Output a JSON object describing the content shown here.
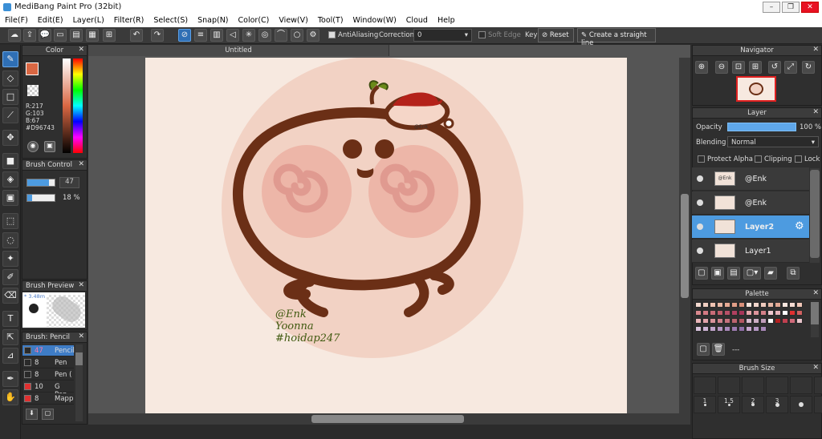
{
  "window": {
    "title": "MediBang Paint Pro (32bit)"
  },
  "menu": [
    "File(F)",
    "Edit(E)",
    "Layer(L)",
    "Filter(R)",
    "Select(S)",
    "Snap(N)",
    "Color(C)",
    "View(V)",
    "Tool(T)",
    "Window(W)",
    "Cloud",
    "Help"
  ],
  "toolbar": {
    "antialiasing": "AntiAliasing",
    "correction_label": "Correction",
    "correction_value": "0",
    "soft_edge": "Soft Edge",
    "key_label": "Key",
    "reset": "Reset",
    "straight_line": "Create a straight line"
  },
  "color_panel": {
    "title": "Color",
    "r": "R:217",
    "g": "G:103",
    "b": "B:67",
    "hex": "#D96743",
    "fg_color": "#D96743"
  },
  "brush_control": {
    "title": "Brush Control",
    "size": "47",
    "opacity": "18 %"
  },
  "brush_preview": {
    "title": "Brush Preview",
    "size_text": "* 3.48m"
  },
  "brush_list": {
    "title": "Brush: Pencil",
    "items": [
      {
        "size": "47",
        "name": "Pencil",
        "color": "#2a2a2a"
      },
      {
        "size": "8",
        "name": "Pen",
        "color": "#2a2a2a"
      },
      {
        "size": "8",
        "name": "Pen (",
        "color": "#2a2a2a"
      },
      {
        "size": "10",
        "name": "G Pen",
        "color": "#e03030"
      },
      {
        "size": "8",
        "name": "Mapp",
        "color": "#e03030"
      }
    ]
  },
  "document": {
    "tab": "Untitled"
  },
  "artwork": {
    "line1": "@Enk",
    "line2": "Yoonna",
    "line3": "#hoidap247",
    "hat_tag": "@Enk"
  },
  "navigator": {
    "title": "Navigator"
  },
  "layer_panel": {
    "title": "Layer",
    "opacity_label": "Opacity",
    "opacity_value": "100 %",
    "blending_label": "Blending",
    "blending_value": "Normal",
    "protect_alpha": "Protect Alpha",
    "clipping": "Clipping",
    "lock": "Lock",
    "layers": [
      {
        "name": "@Enk",
        "selected": false,
        "thumb": "@Enk"
      },
      {
        "name": "@Enk",
        "selected": false,
        "thumb": ""
      },
      {
        "name": "Layer2",
        "selected": true,
        "thumb": ""
      },
      {
        "name": "Layer1",
        "selected": false,
        "thumb": ""
      }
    ]
  },
  "palette": {
    "title": "Palette",
    "dash": "---",
    "rows": [
      [
        "#f3d9cf",
        "#f0cfc2",
        "#efc3b2",
        "#eab8a5",
        "#e8aa94",
        "#e09e88",
        "#d99079",
        "#f6e4dc",
        "#f2d6cc",
        "#eecabd",
        "#e7b8a6",
        "#e1a792",
        "#f8e6de",
        "#f4dbd2",
        "#f0c7b8"
      ],
      [
        "#d9888e",
        "#d37a83",
        "#c96c78",
        "#c05c6a",
        "#b85068",
        "#b04060",
        "#a63558",
        "#e6a5aa",
        "#dd949c",
        "#d48089",
        "#f0c9cf",
        "#e8b5bc",
        "#ffffff",
        "#e03030",
        "#d06060"
      ],
      [
        "#e9b5b9",
        "#e2a4aa",
        "#d9939b",
        "#d0828c",
        "#c7727d",
        "#bd646f",
        "#b35762",
        "#d7bccf",
        "#cdaec5",
        "#c29ebb",
        "#ffffff",
        "#b22020",
        "#c04050",
        "#d06b7a",
        "#e8c6cc"
      ],
      [
        "#d8c3dc",
        "#cdb4d4",
        "#c1a5cb",
        "#b596c2",
        "#a988b9",
        "#9d7bb0",
        "#9070a8",
        "#c8a8d0",
        "#b598c4",
        "#a888b8"
      ]
    ]
  },
  "brush_size": {
    "title": "Brush Size",
    "labels": [
      "1",
      "1.5",
      "2",
      "3"
    ]
  }
}
